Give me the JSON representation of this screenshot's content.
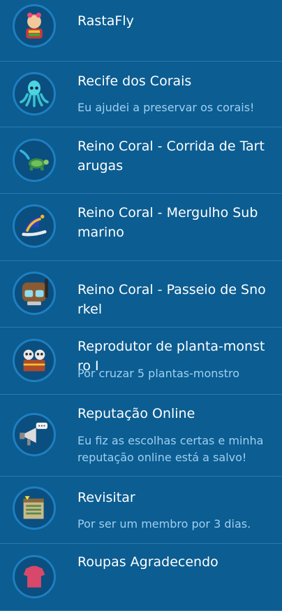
{
  "badges": [
    {
      "title": "RastaFly",
      "description": "",
      "icon": "rasta-avatar-icon"
    },
    {
      "title": "Recife dos Corais",
      "description": "Eu ajudei a preservar os corais!",
      "icon": "squid-icon"
    },
    {
      "title": "Reino Coral - Corrida de Tartarugas",
      "description": "",
      "icon": "sea-turtle-icon"
    },
    {
      "title": "Reino Coral - Mergulho Submarino",
      "description": "",
      "icon": "sea-slug-icon"
    },
    {
      "title": "Reino Coral - Passeio de Snorkel",
      "description": "",
      "icon": "snorkel-mask-icon"
    },
    {
      "title": "Reprodutor de planta-monstro I",
      "description": "Por cruzar 5 plantas-monstro",
      "icon": "skull-chest-icon"
    },
    {
      "title": "Reputação Online",
      "description": "Eu fiz as escolhas certas e minha reputação online está a salvo!",
      "icon": "megaphone-icon"
    },
    {
      "title": "Revisitar",
      "description": "Por ser um membro por 3 dias.",
      "icon": "calendar-book-icon"
    },
    {
      "title": "Roupas Agradecendo",
      "description": "",
      "icon": "clothing-icon"
    }
  ],
  "colors": {
    "background": "#0b5d92",
    "title": "#ffffff",
    "description": "#9fd0f0",
    "badge_ring": "#1e7fbf"
  }
}
